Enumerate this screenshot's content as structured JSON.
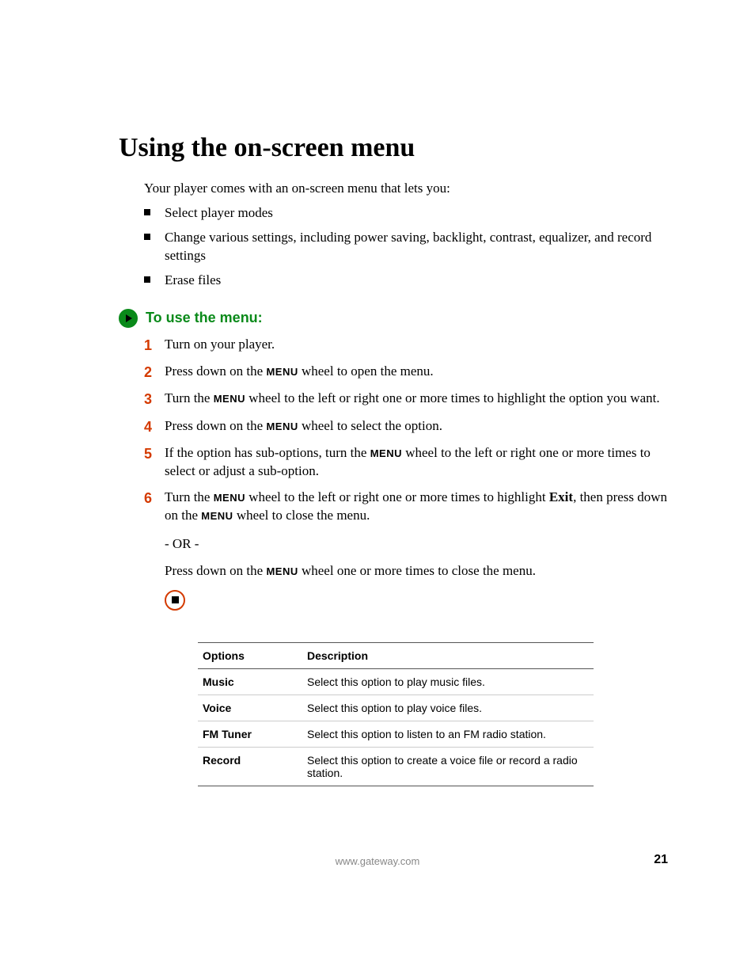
{
  "title": "Using the on-screen menu",
  "intro": "Your player comes with an on-screen menu that lets you:",
  "bullets": [
    "Select player modes",
    "Change various settings, including power saving, backlight, contrast, equalizer, and record settings",
    "Erase files"
  ],
  "section_title": "To use the menu:",
  "menu_word": "MENU",
  "exit_word": "Exit",
  "steps": {
    "s1": "Turn on your player.",
    "s2a": "Press down on the ",
    "s2b": " wheel to open the menu.",
    "s3a": "Turn the ",
    "s3b": " wheel to the left or right one or more times to highlight the option you want.",
    "s4a": "Press down on the ",
    "s4b": " wheel to select the option.",
    "s5a": "If the option has sub-options, turn the ",
    "s5b": " wheel to the left or right one or more times to select or adjust a sub-option.",
    "s6a": "Turn the ",
    "s6b": " wheel to the left or right one or more times to highlight ",
    "s6c": ", then press down on the ",
    "s6d": " wheel to close the menu."
  },
  "or_text": "- OR -",
  "cont_a": "Press down on the ",
  "cont_b": " wheel one or more times to close the menu.",
  "table": {
    "h1": "Options",
    "h2": "Description",
    "rows": [
      {
        "opt": "Music",
        "desc": "Select this option to play music files."
      },
      {
        "opt": "Voice",
        "desc": "Select this option to play voice files."
      },
      {
        "opt": "FM Tuner",
        "desc": "Select this option to listen to an FM radio station."
      },
      {
        "opt": "Record",
        "desc": "Select this option to create a voice file or record a radio station."
      }
    ]
  },
  "footer_url": "www.gateway.com",
  "page_number": "21"
}
